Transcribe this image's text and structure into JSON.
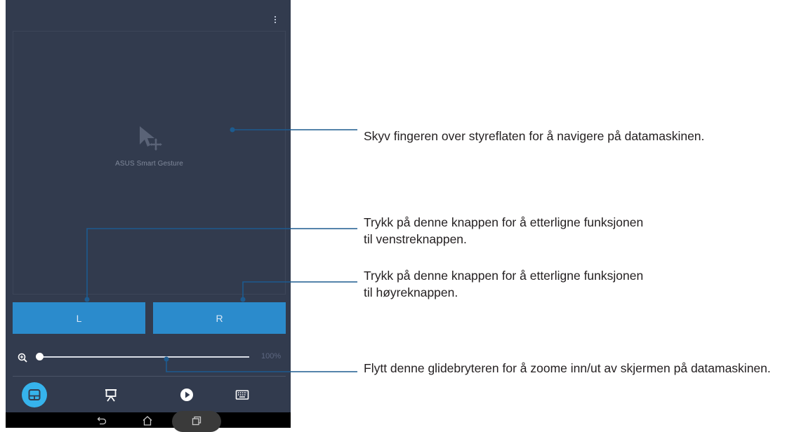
{
  "touchpad": {
    "app_label": "ASUS Smart Gesture",
    "icon": "cursor-move-gesture-icon"
  },
  "mouse_buttons": {
    "left_label": "L",
    "right_label": "R"
  },
  "zoom": {
    "icon": "zoom-in-icon",
    "value_label": "100%",
    "slider_level": 0
  },
  "bottom_tabs": [
    {
      "icon": "touchpad-icon",
      "selected": true
    },
    {
      "icon": "presentation-icon",
      "selected": false
    },
    {
      "icon": "play-circle-icon",
      "selected": false
    },
    {
      "icon": "keyboard-icon",
      "selected": false
    }
  ],
  "system_nav": [
    "back-icon",
    "home-icon",
    "recents-icon"
  ],
  "callouts": {
    "touchpad": "Skyv fingeren over styreflaten for å navigere på datamaskinen.",
    "left_button": "Trykk på denne knappen for å etterligne funksjonen til venstreknappen.",
    "right_button": "Trykk på denne knappen for å etterligne funksjonen til høyreknappen.",
    "zoom_slider": "Flytt denne glidebryteren for å zoome inn/ut av skjermen på datamaskinen."
  },
  "colors": {
    "screen_bg": "#323b4e",
    "button_blue": "#2b8bcc",
    "active_tab": "#36b3ec",
    "callout_line": "#1d5b8f"
  }
}
